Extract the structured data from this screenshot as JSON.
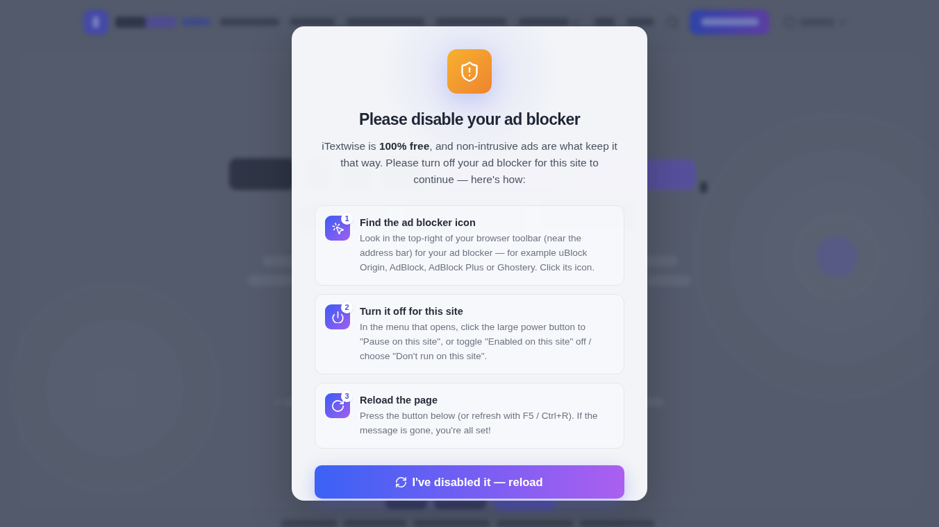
{
  "dialog": {
    "title": "Please disable your ad blocker",
    "message": "iTextwise is **100% free**, and non-intrusive ads are what keep it that way. Please turn off your ad blocker for this site to continue — here's how:",
    "steps": [
      {
        "number": "1",
        "title": "Find the ad blocker icon",
        "text": "Look in the top-right of your browser toolbar (near the address bar) for your ad blocker — for example uBlock Origin, AdBlock, AdBlock Plus or Ghostery. Click its icon."
      },
      {
        "number": "2",
        "title": "Turn it off for this site",
        "text": "In the menu that opens, click the large power button to \"Pause on this site\", or toggle \"Enabled on this site\" off / choose \"Don't run on this site\"."
      },
      {
        "number": "3",
        "title": "Reload the page",
        "text": "Press the button below (or refresh with F5 / Ctrl+R). If the message is gone, you're all set!"
      }
    ],
    "button": "I've disabled it — reload"
  }
}
